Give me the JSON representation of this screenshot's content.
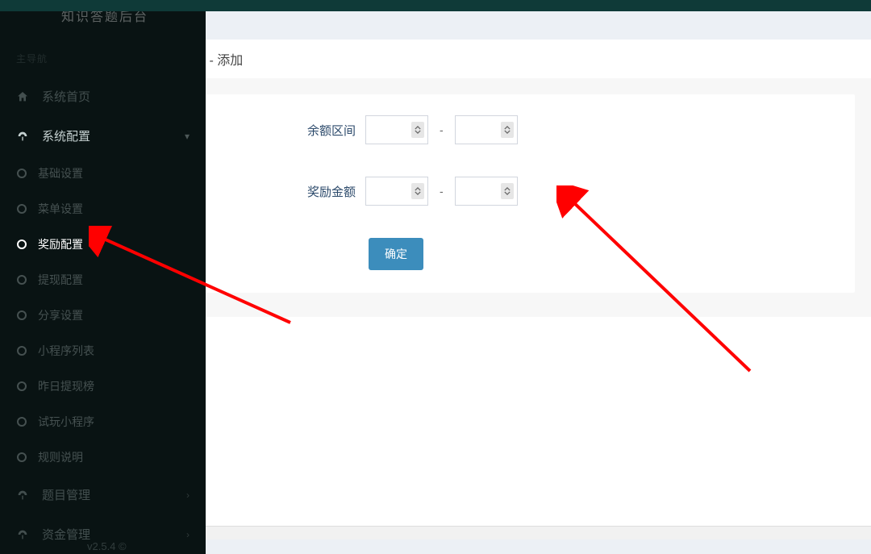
{
  "brand": "知识答题后台",
  "sidebar": {
    "section_label": "主导航",
    "items": [
      {
        "label": "系统首页",
        "icon": "home-icon"
      },
      {
        "label": "系统配置",
        "icon": "dashboard-icon",
        "expanded": true,
        "children": [
          {
            "label": "基础设置"
          },
          {
            "label": "菜单设置"
          },
          {
            "label": "奖励配置",
            "active": true
          },
          {
            "label": "提现配置"
          },
          {
            "label": "分享设置"
          },
          {
            "label": "小程序列表"
          },
          {
            "label": "昨日提现榜"
          },
          {
            "label": "试玩小程序"
          },
          {
            "label": "规则说明"
          }
        ]
      },
      {
        "label": "题目管理",
        "icon": "dashboard-icon"
      },
      {
        "label": "资金管理",
        "icon": "dashboard-icon"
      }
    ]
  },
  "version_fragment": "v2.5.4 ©",
  "modal": {
    "title": "奖励配置 - 添加",
    "rows": [
      {
        "label": "余额区间"
      },
      {
        "label": "奖励金额"
      }
    ],
    "dash": "-",
    "submit_label": "确定"
  }
}
